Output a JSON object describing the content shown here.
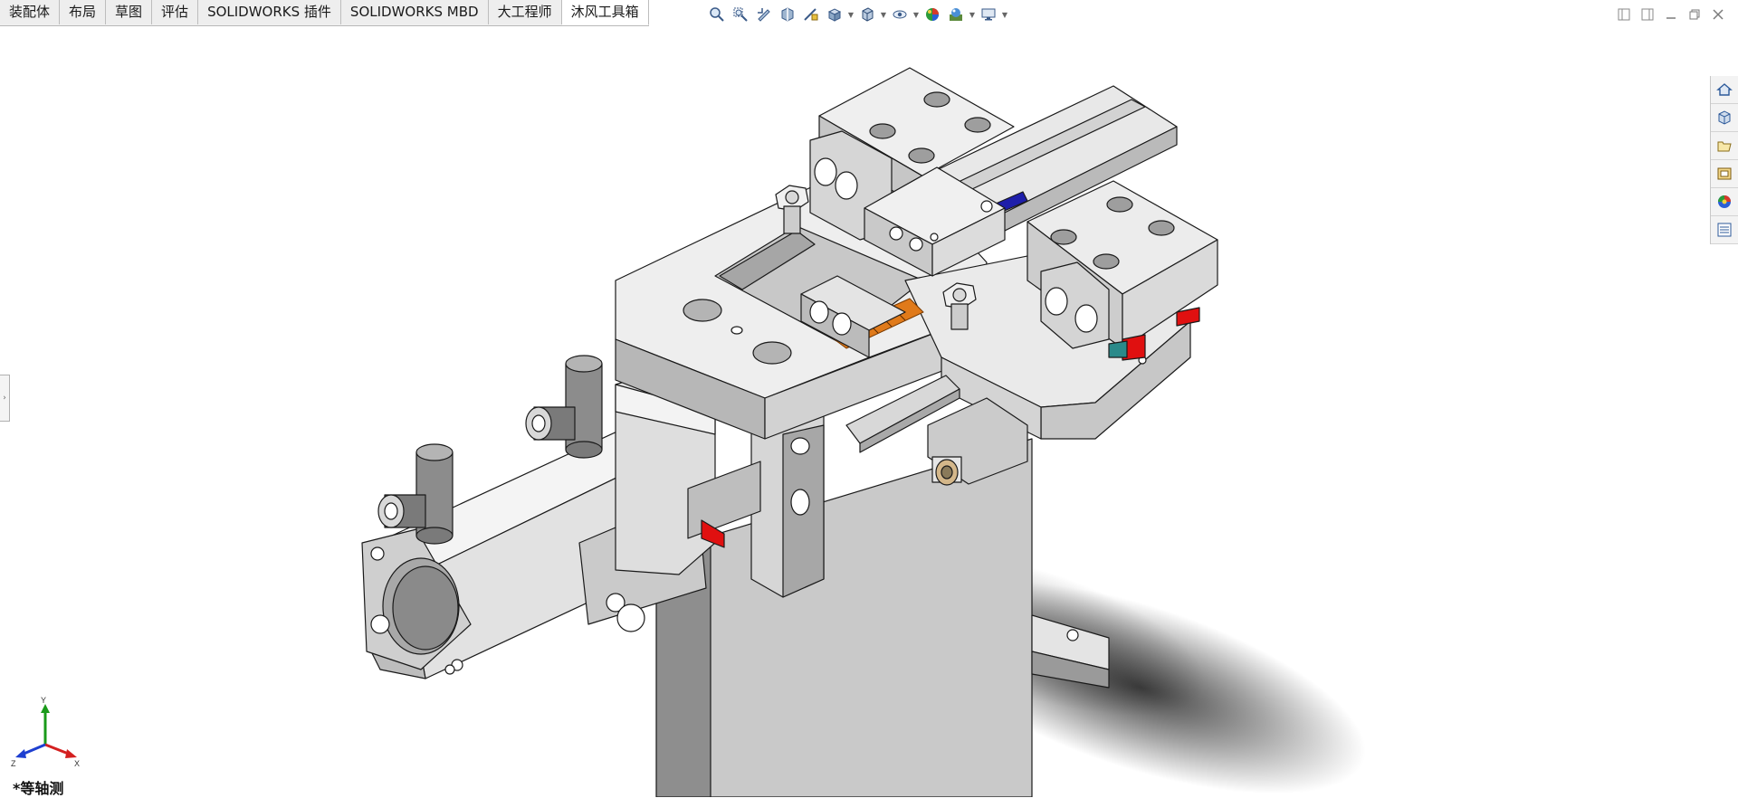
{
  "tabs": [
    {
      "label": "装配体",
      "active": false
    },
    {
      "label": "布局",
      "active": false
    },
    {
      "label": "草图",
      "active": false
    },
    {
      "label": "评估",
      "active": false
    },
    {
      "label": "SOLIDWORKS 插件",
      "active": false
    },
    {
      "label": "SOLIDWORKS MBD",
      "active": false
    },
    {
      "label": "大工程师",
      "active": false
    },
    {
      "label": "沐风工具箱",
      "active": true
    }
  ],
  "hud_icons": [
    "zoom-to-fit-icon",
    "zoom-area-icon",
    "previous-view-icon",
    "section-view-icon",
    "dynamic-annotation-icon",
    "view-orientation-icon",
    "display-style-icon",
    "hide-show-items-icon",
    "edit-appearance-icon",
    "apply-scene-icon",
    "view-settings-icon"
  ],
  "task_pane_icons": [
    "solidworks-resources-icon",
    "design-library-icon",
    "file-explorer-icon",
    "view-palette-icon",
    "appearances-scenes-icon",
    "custom-properties-icon"
  ],
  "view": {
    "name": "*等轴测"
  },
  "triad": {
    "x": "X",
    "y": "Y",
    "z": "Z"
  },
  "colors": {
    "axis_x": "#d42020",
    "axis_y": "#1a9a1a",
    "axis_z": "#1e3fd0",
    "highlight_red": "#e01010",
    "spring_orange": "#e07a1a"
  }
}
